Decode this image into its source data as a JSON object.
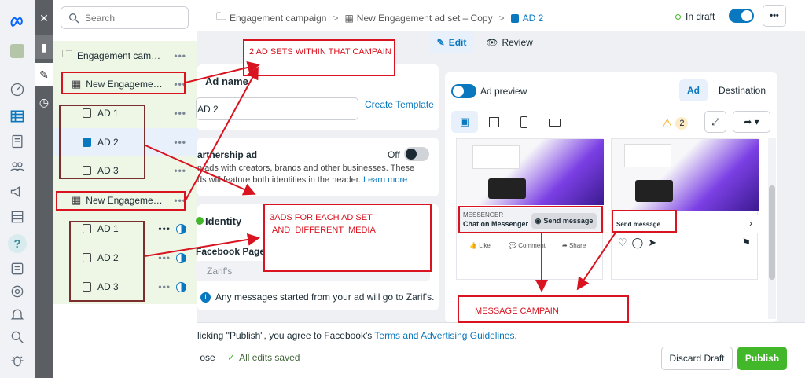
{
  "search": {
    "placeholder": "Search"
  },
  "tree": {
    "campaign": "Engagement campa...",
    "adset1": "New Engagemen...",
    "adset1_ads": [
      "AD 1",
      "AD 2",
      "AD 3"
    ],
    "adset2": "New Engagemen...",
    "adset2_ads": [
      "AD 1",
      "AD 2",
      "AD 3"
    ],
    "more": "•••"
  },
  "breadcrumb": {
    "campaign": "Engagement campaign",
    "adset": "New Engagement ad set – Copy",
    "ad": "AD 2",
    "sep": ">"
  },
  "status": {
    "draft": "In draft"
  },
  "toolbar": {
    "edit": "Edit",
    "review": "Review"
  },
  "adname": {
    "heading": "Ad name",
    "value": "AD 2",
    "create_template": "Create Template"
  },
  "partnership": {
    "heading": "artnership ad",
    "toggle": "Off",
    "desc1": "n ads with creators, brands and other businesses. These",
    "desc2": "ds will feature both identities in the header.",
    "learn_more": "Learn more"
  },
  "identity": {
    "heading": "Identity",
    "fb_page_label": "Facebook Page",
    "page_value": "Zarif's",
    "info": "Any messages started from your ad will go to Zarif's."
  },
  "preview": {
    "label": "Ad preview",
    "tab_ad": "Ad",
    "tab_destination": "Destination",
    "warning_count": "2",
    "messenger_caption": "MESSENGER",
    "chat_on_messenger": "Chat on Messenger",
    "send_message": "Send message",
    "send_message_ig": "Send message",
    "like": "Like",
    "comment": "Comment",
    "share": "Share"
  },
  "footer": {
    "terms_prefix": "licking \"Publish\", you agree to Facebook's",
    "terms_link": "Terms and Advertising Guidelines",
    "terms_suffix": ".",
    "close": "ose",
    "saved": "All edits saved",
    "discard": "Discard Draft",
    "publish": "Publish"
  },
  "annotations": {
    "adsets": "2 AD SETS WITHIN THAT CAMPAIN",
    "ads_line1": "3ADS FOR EACH AD SET",
    "ads_line2": "AND  DIFFERENT  MEDIA",
    "message": "MESSAGE CAMPAIN"
  },
  "colors": {
    "accent": "#0a78be",
    "publish": "#42b72a",
    "annotation": "#d9131f",
    "selected_row": "#e7f0fb",
    "adset_bg": "#eef6e6"
  }
}
